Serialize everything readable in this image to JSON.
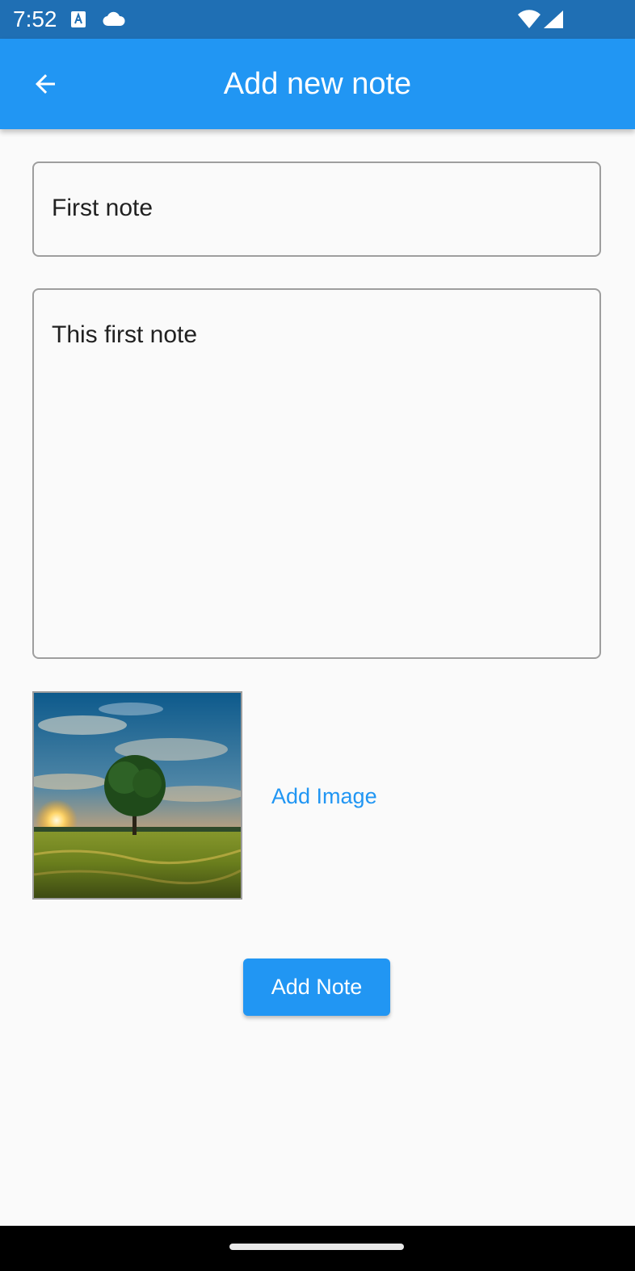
{
  "status_bar": {
    "time": "7:52",
    "icons": [
      "accessibility-a-icon",
      "cloud-icon",
      "wifi-icon",
      "signal-icon"
    ]
  },
  "app_bar": {
    "title": "Add new note",
    "back_icon": "arrow-back-icon",
    "color": "#2196f3"
  },
  "form": {
    "title_value": "First note",
    "body_value": "This first note",
    "image_description": "",
    "add_image_label": "Add Image",
    "add_note_label": "Add Note"
  },
  "colors": {
    "primary": "#2196f3",
    "status_bar": "#1f6fb4",
    "background": "#fafafa",
    "border": "#9e9e9e"
  }
}
